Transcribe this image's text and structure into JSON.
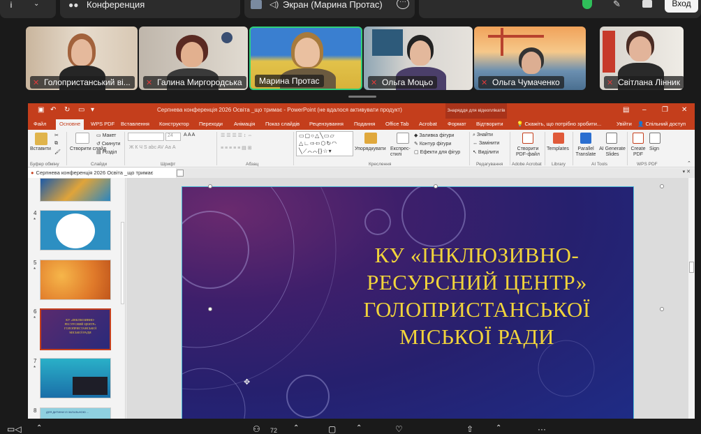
{
  "topbar": {
    "info_glyph": "i",
    "chevron": "⌄",
    "conference_label": "Конференция",
    "screen_share_label": "Экран (Марина Протас)",
    "more_glyph": "···",
    "login_label": "Вход"
  },
  "participants": [
    {
      "name": "Голопристанський ві...",
      "muted": true
    },
    {
      "name": "Галина Миргородська",
      "muted": true
    },
    {
      "name": "Марина Протас",
      "muted": false,
      "active_speaker": true
    },
    {
      "name": "Ольга Моцьо",
      "muted": true
    },
    {
      "name": "Ольга Чумаченко",
      "muted": true
    },
    {
      "name": "Світлана Лінник",
      "muted": true
    }
  ],
  "ppt": {
    "window_title": "Серпнева конференція 2026 Освіта _що тримає - PowerPoint (не вдалося активувати продукт)",
    "drawing_tools_label": "Знаряддя для відеоплікатів",
    "tabs": [
      "Файл",
      "Основне",
      "WPS PDF",
      "Вставлення",
      "Конструктор",
      "Переходи",
      "Анімація",
      "Показ слайдів",
      "Рецензування",
      "Подання",
      "Office Tab",
      "Acrobat",
      "Формат",
      "Відтворити"
    ],
    "tell_me": "Скажіть, що потрібно зробити...",
    "sign_in": "Увійти",
    "share": "Спільний доступ",
    "ribbon": {
      "paste": "Вставити",
      "clipboard_group": "Буфер обміну",
      "new_slide": "Створити слайд",
      "layout": "Макет",
      "reset": "Скинути",
      "section": "Розділ",
      "slides_group": "Слайди",
      "font_size": "24",
      "font_group": "Шрифт",
      "paragraph_group": "Абзац",
      "arrange": "Упорядкувати",
      "quick_styles": "Експрес-стилі",
      "shape_fill": "Заливка фігури",
      "shape_outline": "Контур фігури",
      "shape_effects": "Ефекти для фігур",
      "drawing_group": "Креслення",
      "find": "Знайти",
      "replace": "Замінити",
      "select": "Виділити",
      "editing_group": "Редагування",
      "create_pdf": "Створити PDF-файл",
      "acrobat_group": "Adobe Acrobat",
      "templates": "Templates",
      "library_group": "Library",
      "parallel_translate": "Parallel Translate",
      "ai_generate": "AI Generate Slides",
      "ai_group": "AI Tools",
      "create_pdf_wps": "Create PDF",
      "sign": "Sign",
      "wps_group": "WPS PDF"
    },
    "doc_tab": "Серпнева конференція 2026  Освіта _що тримає",
    "slide_numbers": [
      "4",
      "5",
      "6",
      "7",
      "8"
    ],
    "slide_marker": "*",
    "slide_title": "КУ «ІНКЛЮЗИВНО-РЕСУРСНИЙ ЦЕНТР» ГОЛОПРИСТАНСЬКОЇ МІСЬКОЇ РАДИ",
    "thumb6_text": "КУ «ІНКЛЮЗИВНО-РЕСУРСНИЙ ЦЕНТР» ГОЛОПРИСТАНСЬКОЇ МІСЬКОЇ РАДИ",
    "thumb8_text": "ДЛЯ ДИТИНИ ІЗ ЗАГАЛЬНОЮ ..."
  },
  "bottombar": {
    "participants_count": "72"
  },
  "colors": {
    "ppt_accent": "#c43e1c",
    "slide_title": "#f1d43b",
    "active_speaker": "#2fd07a",
    "muted_mic": "#e23a3a"
  }
}
